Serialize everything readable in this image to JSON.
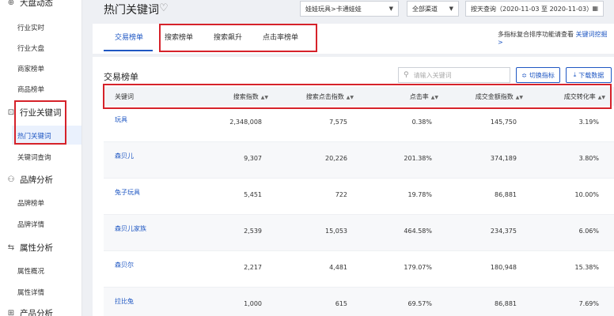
{
  "sidebar": {
    "groups": [
      {
        "label": "大盘动态",
        "icon": "chart-icon"
      },
      {
        "label": "行业关键词",
        "icon": "keyword-icon"
      },
      {
        "label": "品牌分析",
        "icon": "brand-icon"
      },
      {
        "label": "属性分析",
        "icon": "attribute-icon"
      },
      {
        "label": "产品分析",
        "icon": "product-icon"
      }
    ],
    "items": {
      "industry_realtime": "行业实时",
      "industry_overview": "行业大盘",
      "merchant_rank": "商家榜单",
      "product_rank": "商品榜单",
      "hot_keywords": "热门关键词",
      "keyword_query": "关键词查询",
      "brand_rank": "品牌榜单",
      "brand_detail": "品牌详情",
      "attr_overview": "属性概况",
      "attr_detail": "属性详情"
    }
  },
  "header": {
    "title": "热门关键词",
    "category_select": "娃娃玩具>卡通娃娃",
    "channel_select": "全部渠道",
    "date_select": "按天查询（2020-11-03 至 2020-11-03）"
  },
  "tabs": [
    "交易榜单",
    "搜索榜单",
    "搜索飙升",
    "点击率榜单"
  ],
  "tip": {
    "text": "多指标复合排序功能请查看",
    "link": "关键词挖掘 >"
  },
  "section": {
    "title": "交易榜单",
    "search_placeholder": "请输入关键词",
    "switch_btn": "切换指标",
    "download_btn": "下载数据"
  },
  "table": {
    "headers": [
      "关键词",
      "搜索指数",
      "搜索点击指数",
      "点击率",
      "成交金额指数",
      "成交转化率"
    ],
    "rows": [
      [
        "玩具",
        "2,348,008",
        "7,575",
        "0.38%",
        "145,750",
        "3.19%"
      ],
      [
        "森贝儿",
        "9,307",
        "20,226",
        "201.38%",
        "374,189",
        "3.80%"
      ],
      [
        "兔子玩具",
        "5,451",
        "722",
        "19.78%",
        "86,881",
        "10.00%"
      ],
      [
        "森贝儿家族",
        "2,539",
        "15,053",
        "464.58%",
        "234,375",
        "6.06%"
      ],
      [
        "森贝尔",
        "2,217",
        "4,481",
        "179.07%",
        "180,948",
        "15.38%"
      ],
      [
        "拉比兔",
        "1,000",
        "615",
        "69.57%",
        "86,881",
        "7.69%"
      ]
    ]
  },
  "colors": {
    "accent": "#1f57c3",
    "annotation": "#d6222a"
  }
}
